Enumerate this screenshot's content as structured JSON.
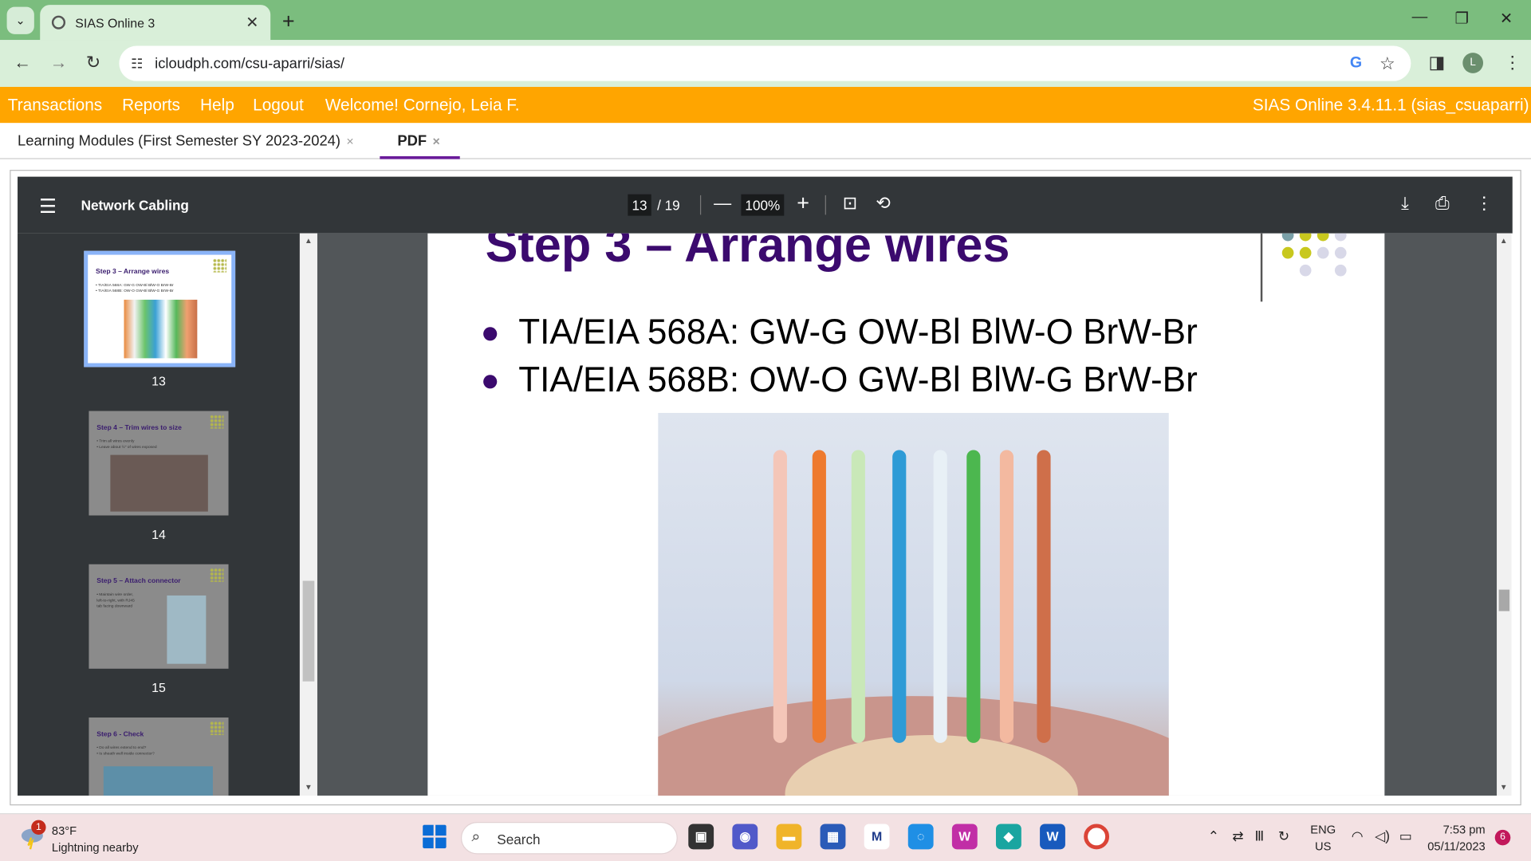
{
  "browser": {
    "tab_title": "SIAS Online 3",
    "url": "icloudph.com/csu-aparri/sias/",
    "profile_initial": "L"
  },
  "app": {
    "menu": [
      "Transactions",
      "Reports",
      "Help",
      "Logout"
    ],
    "welcome": "Welcome! Cornejo, Leia F.",
    "version": "SIAS Online 3.4.11.1 (sias_csuaparri)",
    "tabs": [
      {
        "label": "Learning Modules (First Semester SY 2023-2024)"
      },
      {
        "label": "PDF"
      }
    ],
    "tab_close": "×"
  },
  "pdf": {
    "title": "Network Cabling",
    "page": "13",
    "total": "/ 19",
    "zoom": "100%",
    "thumbnails": [
      {
        "num": "13",
        "title": "Step 3 – Arrange wires",
        "lines": "• TIA/EIA 568A: GW-G OW-Bl BlW-O BrW-Br\n• TIA/EIA 568B: OW-O GW-Bl BlW-G BrW-Br"
      },
      {
        "num": "14",
        "title": "Step 4 – Trim wires to size",
        "lines": "• Trim all wires evenly\n• Leave about ½\" of wires exposed"
      },
      {
        "num": "15",
        "title": "Step 5 – Attach connector",
        "lines": "• Maintain wire order,\nleft-to-right, with RJ45\ntab facing downward"
      },
      {
        "num": "",
        "title": "Step 6 - Check",
        "lines": "• Do all wires extend to end?\n• Is sheath well inside connector?"
      }
    ],
    "slide": {
      "title": "Step 3 – Arrange wires",
      "bullets": [
        "TIA/EIA 568A: GW-G OW-Bl BlW-O BrW-Br",
        "TIA/EIA 568B: OW-O GW-Bl BlW-G BrW-Br"
      ],
      "wire_colors": [
        "#f4c6b8",
        "#ee7a2e",
        "#c9e8b8",
        "#2e9bd6",
        "#e8f0f6",
        "#4cb74f",
        "#f3b9a0",
        "#cf6f4a"
      ]
    }
  },
  "taskbar": {
    "temp": "83°F",
    "weather": "Lightning nearby",
    "weather_badge": "1",
    "search": "Search",
    "lang1": "ENG",
    "lang2": "US",
    "time": "7:53 pm",
    "date": "05/11/2023",
    "notif": "6"
  }
}
